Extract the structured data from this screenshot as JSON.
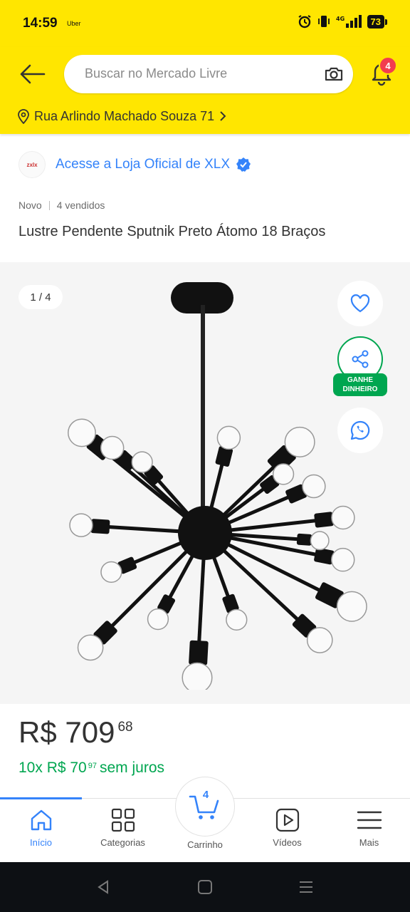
{
  "status_bar": {
    "time": "14:59",
    "app_hint": "Uber",
    "battery": "73"
  },
  "header": {
    "search_placeholder": "Buscar no Mercado Livre",
    "notification_count": "4",
    "address": "Rua Arlindo Machado Souza 71"
  },
  "store": {
    "logo_text": "zxlx",
    "link_label": "Acesse a Loja Oficial de XLX"
  },
  "product": {
    "condition": "Novo",
    "sold": "4 vendidos",
    "title": "Lustre Pendente Sputnik Preto Átomo 18 Braços"
  },
  "gallery": {
    "counter": "1 / 4",
    "earn_badge_line1": "GANHE",
    "earn_badge_line2": "DINHEIRO"
  },
  "price": {
    "main": "R$ 709",
    "cents": "68",
    "installments_prefix": "10x R$ 70",
    "installments_cents": "97",
    "installments_suffix": "sem juros"
  },
  "bottom_nav": {
    "items": [
      {
        "label": "Início",
        "icon": "home-icon"
      },
      {
        "label": "Categorias",
        "icon": "grid-icon"
      },
      {
        "label": "Carrinho",
        "icon": "cart-icon"
      },
      {
        "label": "Vídeos",
        "icon": "play-icon"
      },
      {
        "label": "Mais",
        "icon": "menu-icon"
      }
    ],
    "cart_count": "4"
  },
  "colors": {
    "brand_yellow": "#FFE600",
    "link_blue": "#3483FA",
    "green": "#00A650",
    "badge_red": "#F23D4F"
  }
}
